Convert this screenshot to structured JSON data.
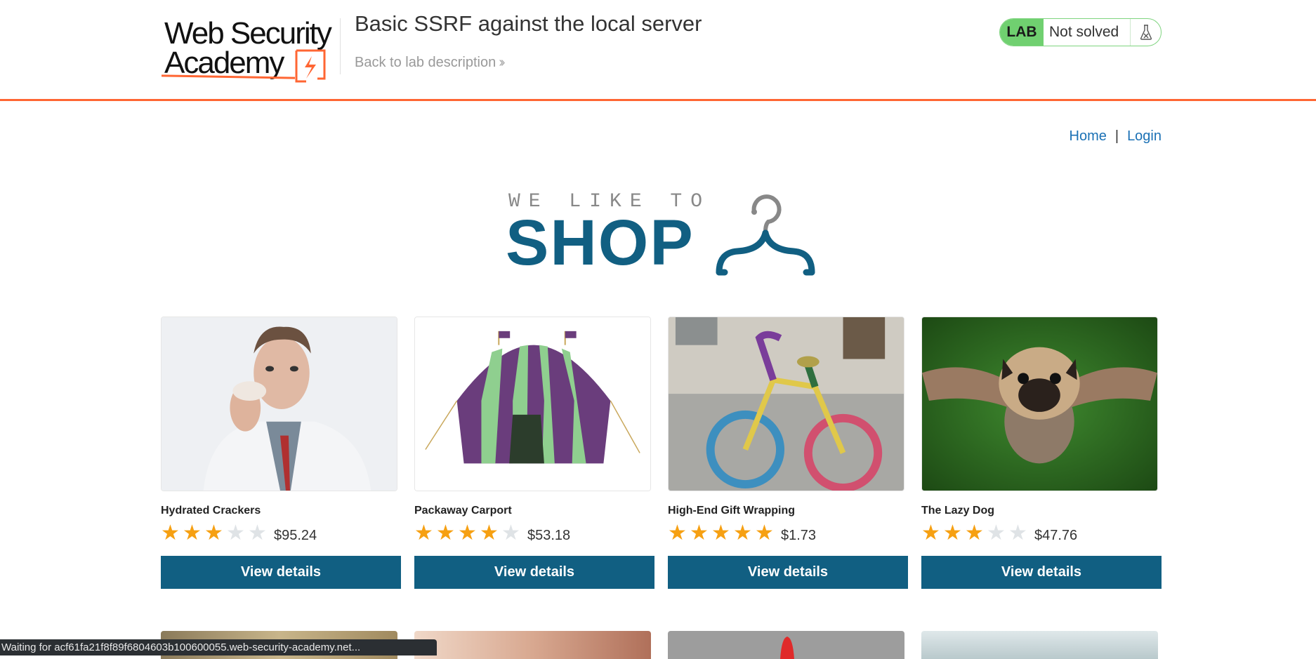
{
  "header": {
    "logo_line1": "Web Security",
    "logo_line2": "Academy",
    "lab_title": "Basic SSRF against the local server",
    "back_link": "Back to lab description",
    "lab_badge": "LAB",
    "lab_status": "Not solved",
    "flask_icon": "flask-icon",
    "accent_color": "#ff6633"
  },
  "nav": {
    "home": "Home",
    "separator": "|",
    "login": "Login"
  },
  "banner": {
    "tagline": "WE LIKE TO",
    "headline": "SHOP",
    "icon": "hanger-icon"
  },
  "products": [
    {
      "name": "Hydrated Crackers",
      "rating": 3,
      "price": "$95.24",
      "button": "View details",
      "image": "man-eating-cracker"
    },
    {
      "name": "Packaway Carport",
      "rating": 4,
      "price": "$53.18",
      "button": "View details",
      "image": "striped-tent"
    },
    {
      "name": "High-End Gift Wrapping",
      "rating": 5,
      "price": "$1.73",
      "button": "View details",
      "image": "yarn-wrapped-bicycle"
    },
    {
      "name": "The Lazy Dog",
      "rating": 3,
      "price": "$47.76",
      "button": "View details",
      "image": "pug-with-wings"
    }
  ],
  "colors": {
    "primary_button": "#115f82",
    "star_on": "#f6a012",
    "star_off": "#dfe3e6",
    "link": "#1b71b5",
    "lab_green": "#70d070"
  },
  "status_bar": {
    "text": "Waiting for acf61fa21f8f89f6804603b100600055.web-security-academy.net..."
  }
}
